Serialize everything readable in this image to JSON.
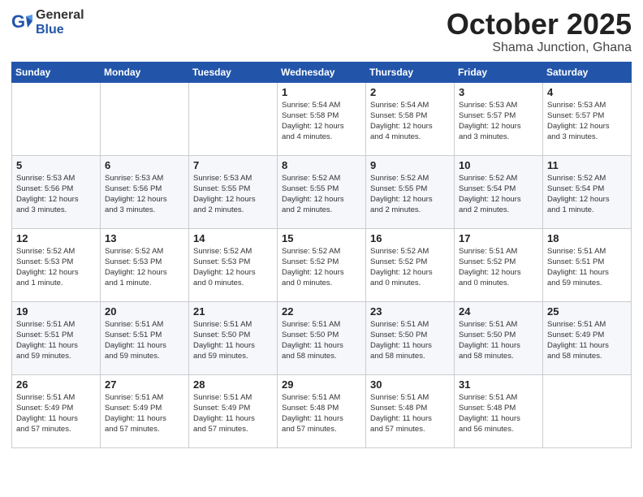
{
  "header": {
    "logo_general": "General",
    "logo_blue": "Blue",
    "month": "October 2025",
    "location": "Shama Junction, Ghana"
  },
  "weekdays": [
    "Sunday",
    "Monday",
    "Tuesday",
    "Wednesday",
    "Thursday",
    "Friday",
    "Saturday"
  ],
  "weeks": [
    [
      {
        "day": "",
        "info": ""
      },
      {
        "day": "",
        "info": ""
      },
      {
        "day": "",
        "info": ""
      },
      {
        "day": "1",
        "info": "Sunrise: 5:54 AM\nSunset: 5:58 PM\nDaylight: 12 hours\nand 4 minutes."
      },
      {
        "day": "2",
        "info": "Sunrise: 5:54 AM\nSunset: 5:58 PM\nDaylight: 12 hours\nand 4 minutes."
      },
      {
        "day": "3",
        "info": "Sunrise: 5:53 AM\nSunset: 5:57 PM\nDaylight: 12 hours\nand 3 minutes."
      },
      {
        "day": "4",
        "info": "Sunrise: 5:53 AM\nSunset: 5:57 PM\nDaylight: 12 hours\nand 3 minutes."
      }
    ],
    [
      {
        "day": "5",
        "info": "Sunrise: 5:53 AM\nSunset: 5:56 PM\nDaylight: 12 hours\nand 3 minutes."
      },
      {
        "day": "6",
        "info": "Sunrise: 5:53 AM\nSunset: 5:56 PM\nDaylight: 12 hours\nand 3 minutes."
      },
      {
        "day": "7",
        "info": "Sunrise: 5:53 AM\nSunset: 5:55 PM\nDaylight: 12 hours\nand 2 minutes."
      },
      {
        "day": "8",
        "info": "Sunrise: 5:52 AM\nSunset: 5:55 PM\nDaylight: 12 hours\nand 2 minutes."
      },
      {
        "day": "9",
        "info": "Sunrise: 5:52 AM\nSunset: 5:55 PM\nDaylight: 12 hours\nand 2 minutes."
      },
      {
        "day": "10",
        "info": "Sunrise: 5:52 AM\nSunset: 5:54 PM\nDaylight: 12 hours\nand 2 minutes."
      },
      {
        "day": "11",
        "info": "Sunrise: 5:52 AM\nSunset: 5:54 PM\nDaylight: 12 hours\nand 1 minute."
      }
    ],
    [
      {
        "day": "12",
        "info": "Sunrise: 5:52 AM\nSunset: 5:53 PM\nDaylight: 12 hours\nand 1 minute."
      },
      {
        "day": "13",
        "info": "Sunrise: 5:52 AM\nSunset: 5:53 PM\nDaylight: 12 hours\nand 1 minute."
      },
      {
        "day": "14",
        "info": "Sunrise: 5:52 AM\nSunset: 5:53 PM\nDaylight: 12 hours\nand 0 minutes."
      },
      {
        "day": "15",
        "info": "Sunrise: 5:52 AM\nSunset: 5:52 PM\nDaylight: 12 hours\nand 0 minutes."
      },
      {
        "day": "16",
        "info": "Sunrise: 5:52 AM\nSunset: 5:52 PM\nDaylight: 12 hours\nand 0 minutes."
      },
      {
        "day": "17",
        "info": "Sunrise: 5:51 AM\nSunset: 5:52 PM\nDaylight: 12 hours\nand 0 minutes."
      },
      {
        "day": "18",
        "info": "Sunrise: 5:51 AM\nSunset: 5:51 PM\nDaylight: 11 hours\nand 59 minutes."
      }
    ],
    [
      {
        "day": "19",
        "info": "Sunrise: 5:51 AM\nSunset: 5:51 PM\nDaylight: 11 hours\nand 59 minutes."
      },
      {
        "day": "20",
        "info": "Sunrise: 5:51 AM\nSunset: 5:51 PM\nDaylight: 11 hours\nand 59 minutes."
      },
      {
        "day": "21",
        "info": "Sunrise: 5:51 AM\nSunset: 5:50 PM\nDaylight: 11 hours\nand 59 minutes."
      },
      {
        "day": "22",
        "info": "Sunrise: 5:51 AM\nSunset: 5:50 PM\nDaylight: 11 hours\nand 58 minutes."
      },
      {
        "day": "23",
        "info": "Sunrise: 5:51 AM\nSunset: 5:50 PM\nDaylight: 11 hours\nand 58 minutes."
      },
      {
        "day": "24",
        "info": "Sunrise: 5:51 AM\nSunset: 5:50 PM\nDaylight: 11 hours\nand 58 minutes."
      },
      {
        "day": "25",
        "info": "Sunrise: 5:51 AM\nSunset: 5:49 PM\nDaylight: 11 hours\nand 58 minutes."
      }
    ],
    [
      {
        "day": "26",
        "info": "Sunrise: 5:51 AM\nSunset: 5:49 PM\nDaylight: 11 hours\nand 57 minutes."
      },
      {
        "day": "27",
        "info": "Sunrise: 5:51 AM\nSunset: 5:49 PM\nDaylight: 11 hours\nand 57 minutes."
      },
      {
        "day": "28",
        "info": "Sunrise: 5:51 AM\nSunset: 5:49 PM\nDaylight: 11 hours\nand 57 minutes."
      },
      {
        "day": "29",
        "info": "Sunrise: 5:51 AM\nSunset: 5:48 PM\nDaylight: 11 hours\nand 57 minutes."
      },
      {
        "day": "30",
        "info": "Sunrise: 5:51 AM\nSunset: 5:48 PM\nDaylight: 11 hours\nand 57 minutes."
      },
      {
        "day": "31",
        "info": "Sunrise: 5:51 AM\nSunset: 5:48 PM\nDaylight: 11 hours\nand 56 minutes."
      },
      {
        "day": "",
        "info": ""
      }
    ]
  ]
}
